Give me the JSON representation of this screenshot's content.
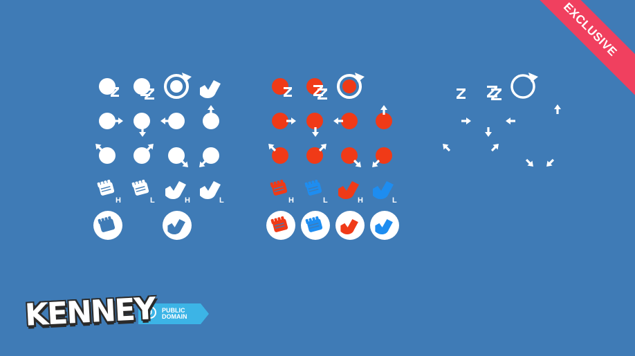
{
  "ribbon": {
    "label": "EXCLUSIVE",
    "color": "#f0405f"
  },
  "logo": {
    "brand": "KENNEY",
    "license_line1": "PUBLIC",
    "license_line2": "DOMAIN",
    "zero": "0"
  },
  "colors": {
    "background": "#3f7bb6",
    "white": "#ffffff",
    "red": "#f03a17",
    "blue": "#1e8df0"
  },
  "sets": [
    "white",
    "colored",
    "small"
  ],
  "icons": [
    {
      "set": "white",
      "name": "sleep-z-icon"
    },
    {
      "set": "white",
      "name": "sleep-zz-icon"
    },
    {
      "set": "white",
      "name": "refresh-circle-icon"
    },
    {
      "set": "white",
      "name": "boot-icon"
    },
    {
      "set": "white",
      "name": "arrow-right-icon"
    },
    {
      "set": "white",
      "name": "arrow-down-icon"
    },
    {
      "set": "white",
      "name": "arrow-left-icon"
    },
    {
      "set": "white",
      "name": "arrow-up-icon"
    },
    {
      "set": "white",
      "name": "arrow-up-left-icon"
    },
    {
      "set": "white",
      "name": "arrow-up-right-icon"
    },
    {
      "set": "white",
      "name": "arrow-down-right-icon"
    },
    {
      "set": "white",
      "name": "arrow-down-left-icon"
    },
    {
      "set": "white",
      "name": "fist-h-icon"
    },
    {
      "set": "white",
      "name": "fist-l-icon"
    },
    {
      "set": "white",
      "name": "boot-h-icon"
    },
    {
      "set": "white",
      "name": "boot-l-icon"
    },
    {
      "set": "white",
      "name": "fist-button-icon"
    },
    {
      "set": "white",
      "name": "boot-button-icon"
    },
    {
      "set": "colored",
      "name": "sleep-z-icon"
    },
    {
      "set": "colored",
      "name": "sleep-zz-icon"
    },
    {
      "set": "colored",
      "name": "refresh-circle-icon"
    },
    {
      "set": "small",
      "name": "sleep-z-icon"
    },
    {
      "set": "small",
      "name": "sleep-zz-icon"
    },
    {
      "set": "small",
      "name": "refresh-circle-icon"
    }
  ],
  "hl_letters": {
    "h": "H",
    "l": "L"
  }
}
